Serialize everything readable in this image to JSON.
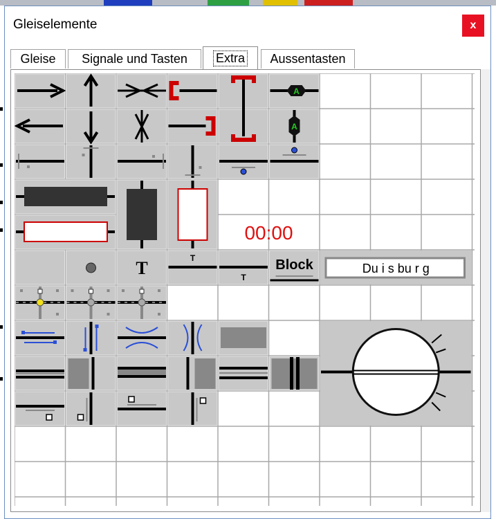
{
  "window": {
    "title": "Gleiselemente",
    "close_label": "x"
  },
  "tabs": [
    {
      "label": "Gleise",
      "active": false
    },
    {
      "label": "Signale und Tasten",
      "active": false
    },
    {
      "label": "Extra",
      "active": true
    },
    {
      "label": "Aussentasten",
      "active": false
    }
  ],
  "palette": {
    "clock_text": "00:00",
    "text_symbol": "T",
    "signal_letter": "A",
    "block_label": "Block",
    "station_label": "Du i s bu r g",
    "colors": {
      "tile_filled": "#c8c8c8",
      "grid_line": "#a8a8a8",
      "track": "#000000",
      "accent_red": "#cc0000",
      "accent_blue": "#2a4fd6",
      "accent_green": "#22cc22",
      "accent_yellow": "#f2e01a",
      "clock_red": "#e01010"
    },
    "elements": [
      {
        "name": "arrow-right-icon"
      },
      {
        "name": "arrow-up-icon"
      },
      {
        "name": "buffer-horizontal-icon"
      },
      {
        "name": "bumper-red-left-icon"
      },
      {
        "name": "bumper-red-top-icon"
      },
      {
        "name": "signal-a-horizontal-icon"
      },
      {
        "name": "arrow-left-icon"
      },
      {
        "name": "arrow-down-icon"
      },
      {
        "name": "buffer-vertical-icon"
      },
      {
        "name": "bumper-red-right-icon"
      },
      {
        "name": "bumper-red-bottom-icon"
      },
      {
        "name": "signal-a-vertical-icon"
      },
      {
        "name": "isolation-left-icon"
      },
      {
        "name": "isolation-top-icon"
      },
      {
        "name": "isolation-right-icon"
      },
      {
        "name": "isolation-bottom-icon"
      },
      {
        "name": "contact-blue-below-icon"
      },
      {
        "name": "contact-blue-above-icon"
      },
      {
        "name": "block-dark-horizontal-icon"
      },
      {
        "name": "block-white-horizontal-icon"
      },
      {
        "name": "block-dark-vertical-icon"
      },
      {
        "name": "block-white-vertical-icon"
      },
      {
        "name": "clock-display"
      },
      {
        "name": "empty-tile-icon"
      },
      {
        "name": "round-button-icon"
      },
      {
        "name": "text-t-icon"
      },
      {
        "name": "label-top-t-icon"
      },
      {
        "name": "label-bottom-t-icon"
      },
      {
        "name": "block-label"
      },
      {
        "name": "station-name-label"
      },
      {
        "name": "level-crossing-yellow-icon"
      },
      {
        "name": "level-crossing-grey-icon"
      },
      {
        "name": "level-crossing-grey-2-icon"
      },
      {
        "name": "bridge-blue-horizontal-icon"
      },
      {
        "name": "bridge-blue-vertical-icon"
      },
      {
        "name": "tunnel-blue-horizontal-icon"
      },
      {
        "name": "tunnel-blue-vertical-icon"
      },
      {
        "name": "grey-bar-icon"
      },
      {
        "name": "turntable-icon"
      },
      {
        "name": "platform-horizontal-icon"
      },
      {
        "name": "platform-vertical-icon"
      },
      {
        "name": "platform-horizontal-2-icon"
      },
      {
        "name": "platform-vertical-2-icon"
      },
      {
        "name": "platform-double-horizontal-icon"
      },
      {
        "name": "platform-double-vertical-icon"
      },
      {
        "name": "key-bottom-right-icon"
      },
      {
        "name": "key-bottom-left-icon"
      },
      {
        "name": "key-top-left-icon"
      },
      {
        "name": "key-top-right-icon"
      }
    ]
  }
}
